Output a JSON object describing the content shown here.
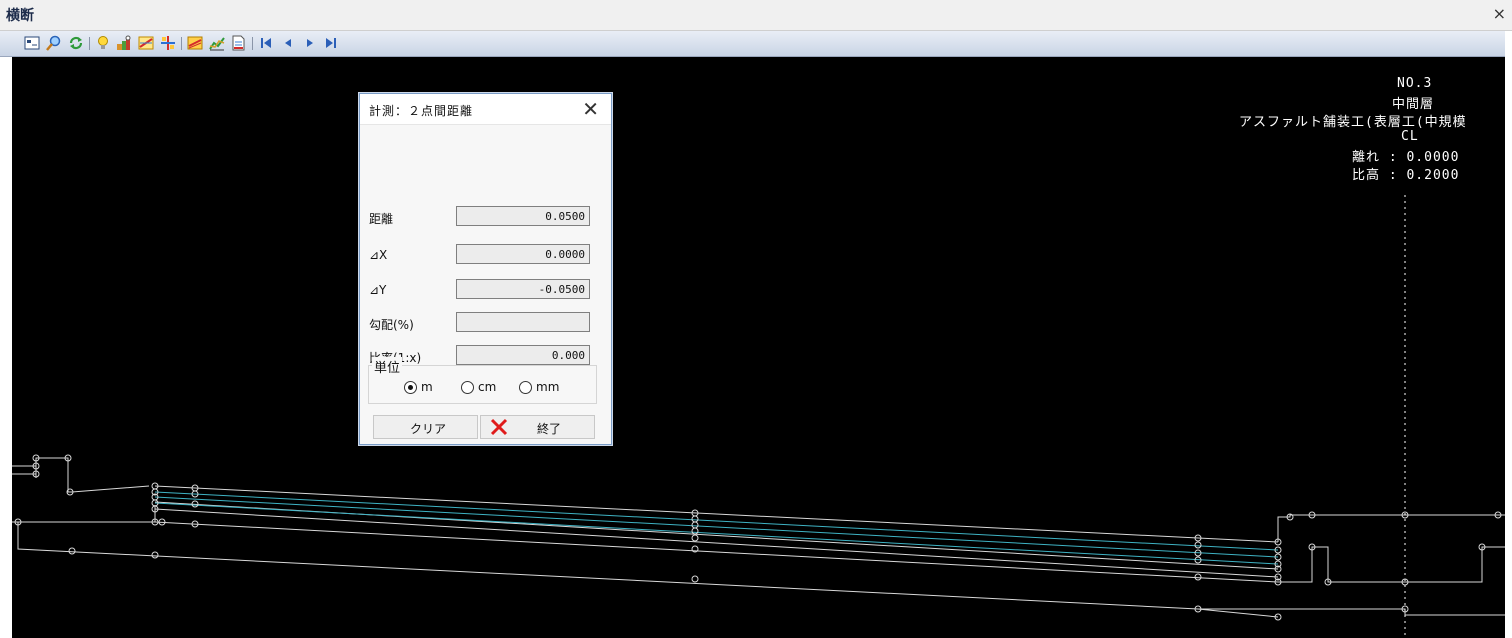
{
  "window": {
    "title": "横断",
    "close_glyph": "×"
  },
  "toolbar": {
    "items": [
      "preview-icon",
      "zoom-icon",
      "refresh-icon",
      "bulb-icon",
      "settings-tool-icon",
      "measure-icon",
      "grid-icon",
      "layer-icon",
      "chart-icon",
      "document-icon",
      "first-icon",
      "prev-icon",
      "next-icon",
      "last-icon"
    ]
  },
  "info": {
    "station": "NO.3",
    "layer": "中間層",
    "work": "アスファルト舗装工(表層工(中規模",
    "cl": "CL",
    "offset": "離れ : 0.0000",
    "height": "比高 : 0.2000"
  },
  "dialog": {
    "title": "計測：２点間距離",
    "close_glyph": "✕",
    "fields": [
      {
        "label": "距離",
        "value": "0.0500"
      },
      {
        "label": "⊿X",
        "value": "0.0000"
      },
      {
        "label": "⊿Y",
        "value": "-0.0500"
      },
      {
        "label": "勾配(%)",
        "value": ""
      },
      {
        "label": "比率(1:x)",
        "value": "0.000"
      }
    ],
    "unit_label": "単位",
    "units": [
      {
        "label": "m",
        "selected": true
      },
      {
        "label": "cm",
        "selected": false
      },
      {
        "label": "mm",
        "selected": false
      }
    ],
    "clear_label": "クリア",
    "exit_label": "終了"
  },
  "colors": {
    "accent_red": "#e01b1b",
    "cross_section_line": "#d9d9d9",
    "layer_line": "#3fb3c4"
  }
}
